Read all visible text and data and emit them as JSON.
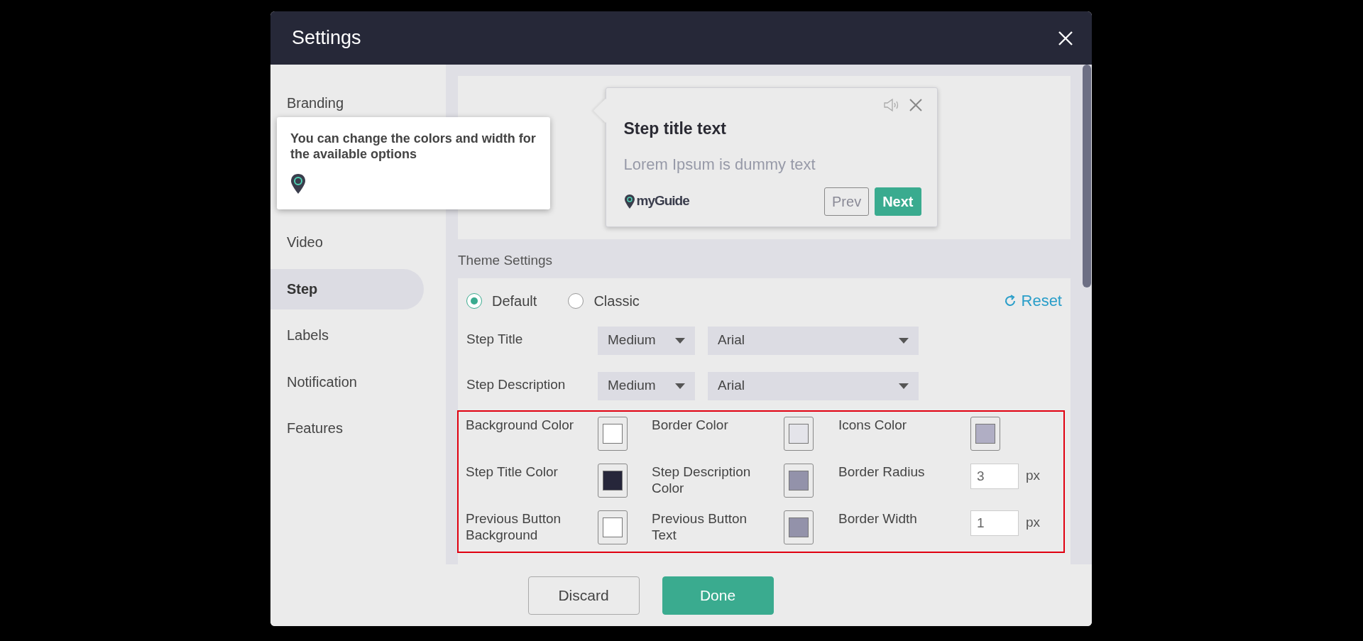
{
  "window": {
    "title": "Settings"
  },
  "sidebar": {
    "items": [
      {
        "label": "Branding",
        "selected": false
      },
      {
        "label": "Video",
        "selected": false
      },
      {
        "label": "Step",
        "selected": true
      },
      {
        "label": "Labels",
        "selected": false
      },
      {
        "label": "Notification",
        "selected": false
      },
      {
        "label": "Features",
        "selected": false
      }
    ]
  },
  "coach_tooltip": {
    "text": "You can change the colors and width for the available options"
  },
  "preview": {
    "title": "Step title text",
    "description": "Lorem Ipsum is dummy text",
    "logo": "myGuide",
    "buttons": [
      {
        "label": "Prev",
        "kind": "outline"
      },
      {
        "label": "Next",
        "kind": "primary"
      }
    ]
  },
  "theme": {
    "title": "Theme Settings",
    "options": [
      {
        "label": "Default",
        "selected": true
      },
      {
        "label": "Classic",
        "selected": false
      }
    ],
    "reset": "Reset",
    "fonts": [
      {
        "label": "Step Title",
        "size": "Medium",
        "family": "Arial"
      },
      {
        "label": "Step Description",
        "size": "Medium",
        "family": "Arial"
      }
    ],
    "settings": [
      {
        "kind": "color",
        "label": "Background Color",
        "color": "#ffffff"
      },
      {
        "kind": "color",
        "label": "Border Color",
        "color": "#e4e4ea"
      },
      {
        "kind": "color",
        "label": "Icons Color",
        "color": "#b0aec4"
      },
      {
        "kind": "color",
        "label": "Step Title Color",
        "color": "#26263a"
      },
      {
        "kind": "color",
        "label": "Step Description Color",
        "color": "#9392aa"
      },
      {
        "kind": "number",
        "label": "Border Radius",
        "value": "3",
        "unit": "px"
      },
      {
        "kind": "color",
        "label": "Previous Button Background",
        "color": "#ffffff"
      },
      {
        "kind": "color",
        "label": "Previous Button Text",
        "color": "#9392aa"
      },
      {
        "kind": "number",
        "label": "Border Width",
        "value": "1",
        "unit": "px"
      }
    ]
  },
  "footer": {
    "buttons": [
      {
        "label": "Discard",
        "kind": "secondary"
      },
      {
        "label": "Done",
        "kind": "primary"
      }
    ]
  }
}
